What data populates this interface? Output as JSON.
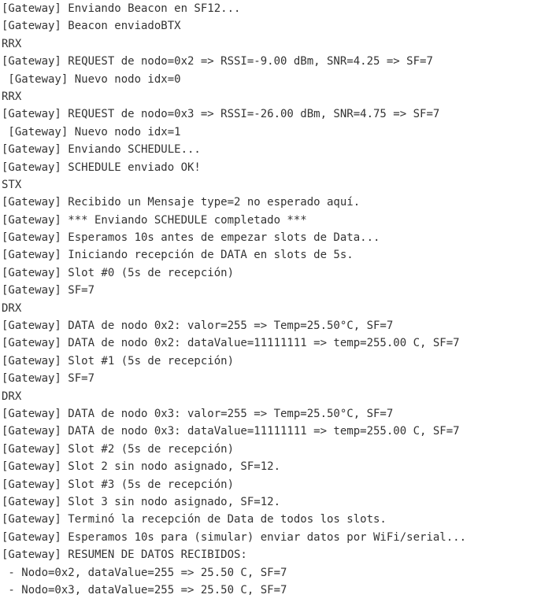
{
  "console": {
    "lines": [
      "[Gateway] Enviando Beacon en SF12...",
      "[Gateway] Beacon enviadoBTX",
      "RRX",
      "[Gateway] REQUEST de nodo=0x2 => RSSI=-9.00 dBm, SNR=4.25 => SF=7",
      " [Gateway] Nuevo nodo idx=0",
      "RRX",
      "[Gateway] REQUEST de nodo=0x3 => RSSI=-26.00 dBm, SNR=4.75 => SF=7",
      " [Gateway] Nuevo nodo idx=1",
      "[Gateway] Enviando SCHEDULE...",
      "[Gateway] SCHEDULE enviado OK!",
      "STX",
      "[Gateway] Recibido un Mensaje type=2 no esperado aquí.",
      "[Gateway] *** Enviando SCHEDULE completado ***",
      "[Gateway] Esperamos 10s antes de empezar slots de Data...",
      "[Gateway] Iniciando recepción de DATA en slots de 5s.",
      "[Gateway] Slot #0 (5s de recepción)",
      "[Gateway] SF=7",
      "DRX",
      "[Gateway] DATA de nodo 0x2: valor=255 => Temp=25.50°C, SF=7",
      "[Gateway] DATA de nodo 0x2: dataValue=11111111 => temp=255.00 C, SF=7",
      "[Gateway] Slot #1 (5s de recepción)",
      "[Gateway] SF=7",
      "DRX",
      "[Gateway] DATA de nodo 0x3: valor=255 => Temp=25.50°C, SF=7",
      "[Gateway] DATA de nodo 0x3: dataValue=11111111 => temp=255.00 C, SF=7",
      "[Gateway] Slot #2 (5s de recepción)",
      "[Gateway] Slot 2 sin nodo asignado, SF=12.",
      "[Gateway] Slot #3 (5s de recepción)",
      "[Gateway] Slot 3 sin nodo asignado, SF=12.",
      "[Gateway] Terminó la recepción de Data de todos los slots.",
      "[Gateway] Esperamos 10s para (simular) enviar datos por WiFi/serial...",
      "[Gateway] RESUMEN DE DATOS RECIBIDOS:",
      " - Nodo=0x2, dataValue=255 => 25.50 C, SF=7",
      " - Nodo=0x3, dataValue=255 => 25.50 C, SF=7"
    ]
  }
}
